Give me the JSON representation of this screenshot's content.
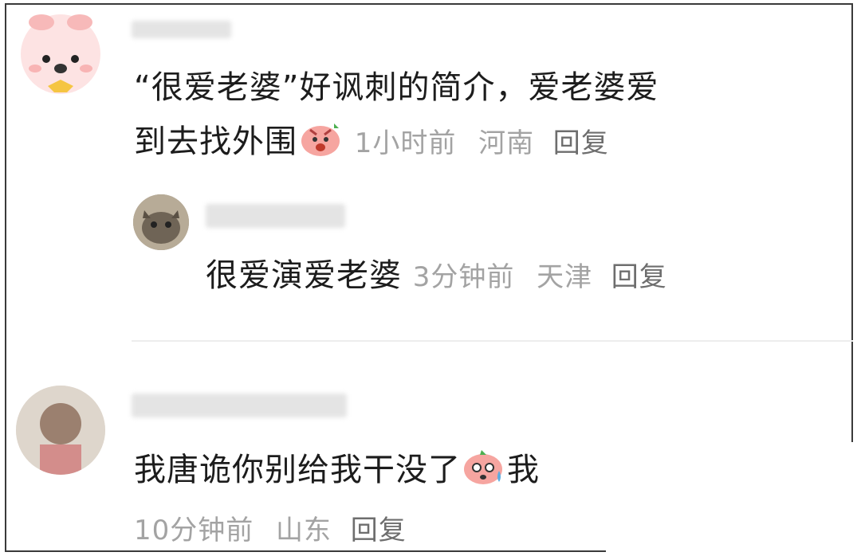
{
  "comments": [
    {
      "text_line1": "“很爱老婆”好讽刺的简介，爱老婆爱",
      "text_line2": "到去找外围",
      "time": "1小时前",
      "location": "河南",
      "reply_label": "回复",
      "emoji": "angry-pig-emoji"
    },
    {
      "text": "很爱演爱老婆",
      "time": "3分钟前",
      "location": "天津",
      "reply_label": "回复"
    },
    {
      "text": "我唐诡你别给我干没了",
      "text_tail": "我",
      "time": "10分钟前",
      "location": "山东",
      "reply_label": "回复",
      "emoji": "sweating-pig-emoji"
    }
  ],
  "colors": {
    "meta": "#a3a3a3",
    "reply": "#6e6e6e",
    "text": "#1c1c1c"
  }
}
